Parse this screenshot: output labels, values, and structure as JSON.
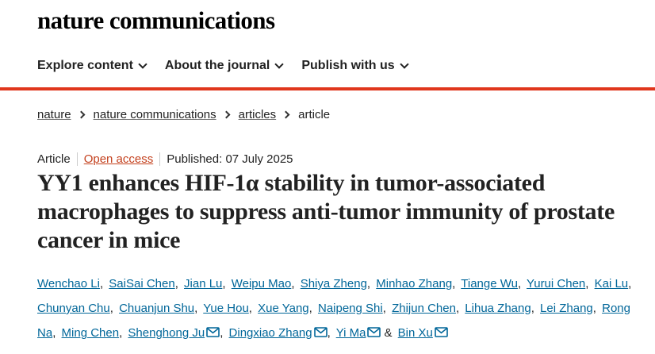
{
  "site": {
    "logo": "nature communications"
  },
  "nav": {
    "items": [
      {
        "label": "Explore content"
      },
      {
        "label": "About the journal"
      },
      {
        "label": "Publish with us"
      }
    ]
  },
  "breadcrumb": {
    "items": [
      "nature",
      "nature communications",
      "articles"
    ],
    "current": "article"
  },
  "article": {
    "type": "Article",
    "open_access": "Open access",
    "published": "Published: 07 July 2025",
    "title": "YY1 enhances HIF-1α stability in tumor-associated macrophages to suppress anti-tumor immunity of prostate cancer in mice",
    "authors": [
      {
        "name": "Wenchao Li",
        "sep": ",",
        "email": false
      },
      {
        "name": "SaiSai Chen",
        "sep": ",",
        "email": false
      },
      {
        "name": "Jian Lu",
        "sep": ",",
        "email": false
      },
      {
        "name": "Weipu Mao",
        "sep": ",",
        "email": false
      },
      {
        "name": "Shiya Zheng",
        "sep": ",",
        "email": false
      },
      {
        "name": "Minhao Zhang",
        "sep": ",",
        "email": false
      },
      {
        "name": "Tiange Wu",
        "sep": ",",
        "email": false
      },
      {
        "name": "Yurui Chen",
        "sep": ",",
        "email": false
      },
      {
        "name": "Kai Lu",
        "sep": ",",
        "email": false
      },
      {
        "name": "Chunyan Chu",
        "sep": ",",
        "email": false
      },
      {
        "name": "Chuanjun Shu",
        "sep": ",",
        "email": false
      },
      {
        "name": "Yue Hou",
        "sep": ",",
        "email": false
      },
      {
        "name": "Xue Yang",
        "sep": ",",
        "email": false
      },
      {
        "name": "Naipeng Shi",
        "sep": ",",
        "email": false
      },
      {
        "name": "Zhijun Chen",
        "sep": ",",
        "email": false
      },
      {
        "name": "Lihua Zhang",
        "sep": ",",
        "email": false
      },
      {
        "name": "Lei Zhang",
        "sep": ",",
        "email": false
      },
      {
        "name": "Rong Na",
        "sep": ",",
        "email": false
      },
      {
        "name": "Ming Chen",
        "sep": ",",
        "email": false
      },
      {
        "name": "Shenghong Ju",
        "sep": ",",
        "email": true
      },
      {
        "name": "Dingxiao Zhang",
        "sep": ",",
        "email": true
      },
      {
        "name": "Yi Ma",
        "sep": "&",
        "email": true
      },
      {
        "name": "Bin Xu",
        "sep": "",
        "email": true
      }
    ]
  },
  "colors": {
    "accent_bar": "#e0361c",
    "open_access": "#c4411e",
    "author_link": "#006699"
  },
  "icons": {
    "author_contact": "envelope-icon",
    "nav_expand": "chevron-down-icon",
    "breadcrumb_separator": "chevron-right-icon"
  }
}
